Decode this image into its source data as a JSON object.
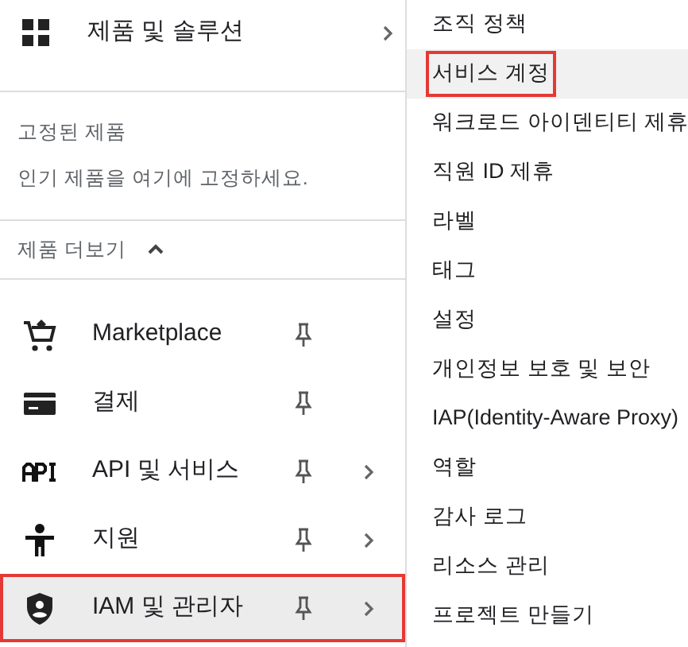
{
  "header": {
    "label": "제품 및 솔루션"
  },
  "pinned": {
    "title": "고정된 제품",
    "hint": "인기 제품을 여기에 고정하세요."
  },
  "more": {
    "label": "제품 더보기",
    "expanded": true
  },
  "products": [
    {
      "label": "Marketplace",
      "kind": "cart",
      "submenu": false,
      "selected": false
    },
    {
      "label": "결제",
      "kind": "card",
      "submenu": false,
      "selected": false
    },
    {
      "label": "API 및 서비스",
      "kind": "api",
      "submenu": true,
      "selected": false
    },
    {
      "label": "지원",
      "kind": "person",
      "submenu": true,
      "selected": false
    },
    {
      "label": "IAM 및 관리자",
      "kind": "shield",
      "submenu": true,
      "selected": true
    }
  ],
  "submenu": [
    {
      "label": "조직 정책",
      "selected": false
    },
    {
      "label": "서비스 계정",
      "selected": true
    },
    {
      "label": "워크로드 아이덴티티 제휴",
      "selected": false
    },
    {
      "label": "직원 ID 제휴",
      "selected": false
    },
    {
      "label": "라벨",
      "selected": false
    },
    {
      "label": "태그",
      "selected": false
    },
    {
      "label": "설정",
      "selected": false
    },
    {
      "label": "개인정보 보호 및 보안",
      "selected": false
    },
    {
      "label": "IAP(Identity-Aware Proxy)",
      "selected": false
    },
    {
      "label": "역할",
      "selected": false
    },
    {
      "label": "감사 로그",
      "selected": false
    },
    {
      "label": "리소스 관리",
      "selected": false
    },
    {
      "label": "프로젝트 만들기",
      "selected": false
    }
  ]
}
